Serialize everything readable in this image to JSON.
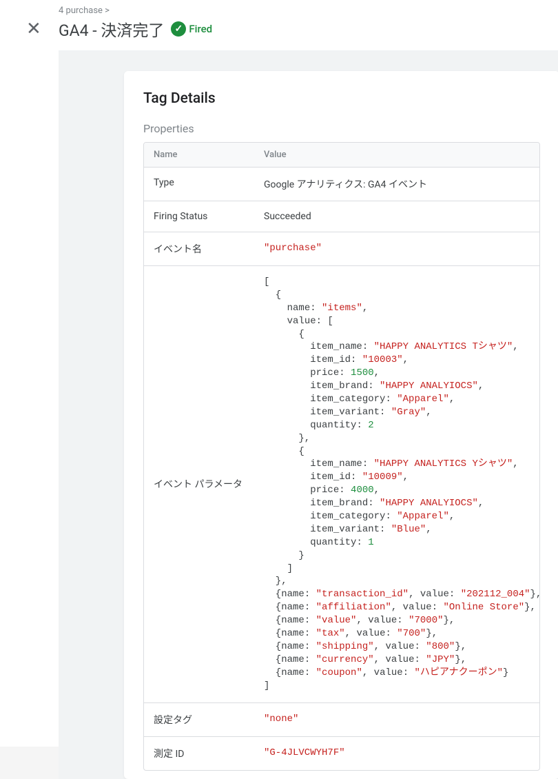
{
  "breadcrumb": "4 purchase >",
  "title": "GA4 - 決済完了",
  "fired_label": "Fired",
  "card_title": "Tag Details",
  "section_title": "Properties",
  "table_head_name": "Name",
  "table_head_value": "Value",
  "rows": {
    "type": {
      "name": "Type",
      "value": "Google アナリティクス: GA4 イベント"
    },
    "firing_status": {
      "name": "Firing Status",
      "value": "Succeeded"
    },
    "event_name": {
      "name": "イベント名",
      "value": "\"purchase\""
    },
    "event_params": {
      "name": "イベント パラメータ"
    },
    "config_tag": {
      "name": "設定タグ",
      "value": "\"none\""
    },
    "measurement_id": {
      "name": "測定 ID",
      "value": "\"G-4JLVCWYH7F\""
    }
  },
  "event_params_data": {
    "items": [
      {
        "item_name": "HAPPY ANALYTICS Tシャツ",
        "item_id": "10003",
        "price": 1500,
        "item_brand": "HAPPY ANALYIOCS",
        "item_category": "Apparel",
        "item_variant": "Gray",
        "quantity": 2
      },
      {
        "item_name": "HAPPY ANALYTICS Yシャツ",
        "item_id": "10009",
        "price": 4000,
        "item_brand": "HAPPY ANALYIOCS",
        "item_category": "Apparel",
        "item_variant": "Blue",
        "quantity": 1
      }
    ],
    "extras": [
      {
        "name": "transaction_id",
        "value_str": "202112_004"
      },
      {
        "name": "affiliation",
        "value_str": "Online Store"
      },
      {
        "name": "value",
        "value_str": "7000"
      },
      {
        "name": "tax",
        "value_str": "700"
      },
      {
        "name": "shipping",
        "value_str": "800"
      },
      {
        "name": "currency",
        "value_str": "JPY"
      },
      {
        "name": "coupon",
        "value_str": "ハピアナクーポン"
      }
    ]
  }
}
